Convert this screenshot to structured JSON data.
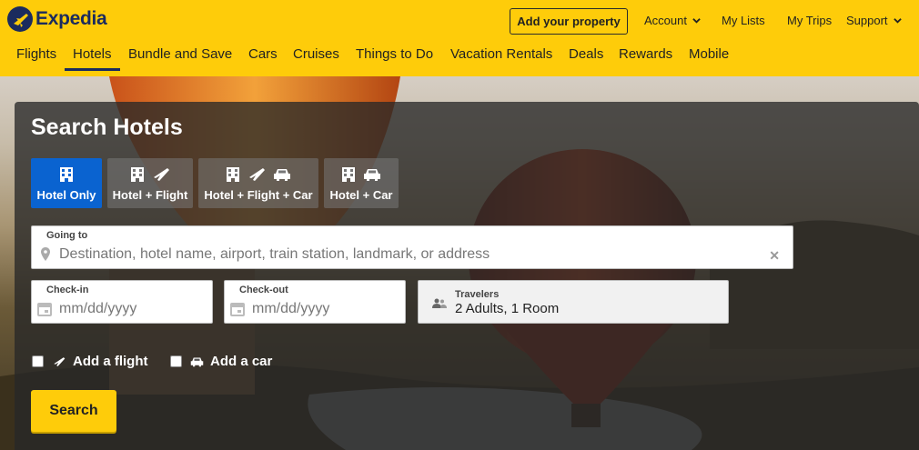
{
  "brand": {
    "name": "Expedia"
  },
  "header": {
    "add_property": "Add your property",
    "links": [
      {
        "label": "Account",
        "has_caret": true
      },
      {
        "label": "My Lists",
        "has_caret": false
      },
      {
        "label": "My Trips",
        "has_caret": false
      },
      {
        "label": "Support",
        "has_caret": true
      }
    ]
  },
  "nav": {
    "items": [
      {
        "label": "Flights"
      },
      {
        "label": "Hotels",
        "active": true
      },
      {
        "label": "Bundle and Save"
      },
      {
        "label": "Cars"
      },
      {
        "label": "Cruises"
      },
      {
        "label": "Things to Do"
      },
      {
        "label": "Vacation Rentals"
      },
      {
        "label": "Deals"
      },
      {
        "label": "Rewards"
      },
      {
        "label": "Mobile"
      }
    ]
  },
  "search": {
    "title": "Search Hotels",
    "tabs": [
      {
        "label": "Hotel Only",
        "icons": [
          "hotel-icon"
        ],
        "active": true
      },
      {
        "label": "Hotel + Flight",
        "icons": [
          "hotel-icon",
          "plane-icon"
        ]
      },
      {
        "label": "Hotel + Flight + Car",
        "icons": [
          "hotel-icon",
          "plane-icon",
          "car-icon"
        ]
      },
      {
        "label": "Hotel + Car",
        "icons": [
          "hotel-icon",
          "car-icon"
        ]
      }
    ],
    "going_to": {
      "label": "Going to",
      "placeholder": "Destination, hotel name, airport, train station, landmark, or address",
      "icon": "location-pin-icon"
    },
    "check_in": {
      "label": "Check-in",
      "placeholder": "mm/dd/yyyy",
      "icon": "calendar-icon"
    },
    "check_out": {
      "label": "Check-out",
      "placeholder": "mm/dd/yyyy",
      "icon": "calendar-icon"
    },
    "travelers": {
      "label": "Travelers",
      "value": "2 Adults, 1 Room",
      "icon": "people-icon"
    },
    "add_flight": {
      "label": "Add a flight",
      "checked": false,
      "icon": "plane-icon"
    },
    "add_car": {
      "label": "Add a car",
      "checked": false,
      "icon": "car-icon"
    },
    "submit": "Search"
  },
  "colors": {
    "header_bg": "#fecc0a",
    "brand_navy": "#1b2b5e",
    "active_tab": "#0a63d0",
    "search_button": "#fecc0a"
  }
}
